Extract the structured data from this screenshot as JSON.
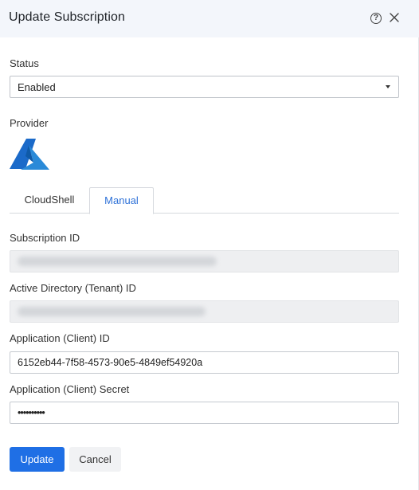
{
  "dialog": {
    "title": "Update Subscription"
  },
  "status": {
    "label": "Status",
    "value": "Enabled"
  },
  "provider": {
    "label": "Provider",
    "logo": "azure-logo"
  },
  "tabs": [
    {
      "label": "CloudShell",
      "active": false
    },
    {
      "label": "Manual",
      "active": true
    }
  ],
  "form": {
    "subscription_id": {
      "label": "Subscription ID",
      "value": ""
    },
    "tenant_id": {
      "label": "Active Directory (Tenant) ID",
      "value": ""
    },
    "client_id": {
      "label": "Application (Client) ID",
      "value": "6152eb44-7f58-4573-90e5-4849ef54920a"
    },
    "client_secret": {
      "label": "Application (Client) Secret",
      "value": "••••••••••"
    }
  },
  "actions": {
    "update_label": "Update",
    "cancel_label": "Cancel"
  },
  "colors": {
    "accent": "#1f6fe5",
    "header_bg": "#f3f6fb",
    "disabled_field": "#eeeff1"
  },
  "icons": {
    "help": "help-icon",
    "close": "close-icon"
  }
}
